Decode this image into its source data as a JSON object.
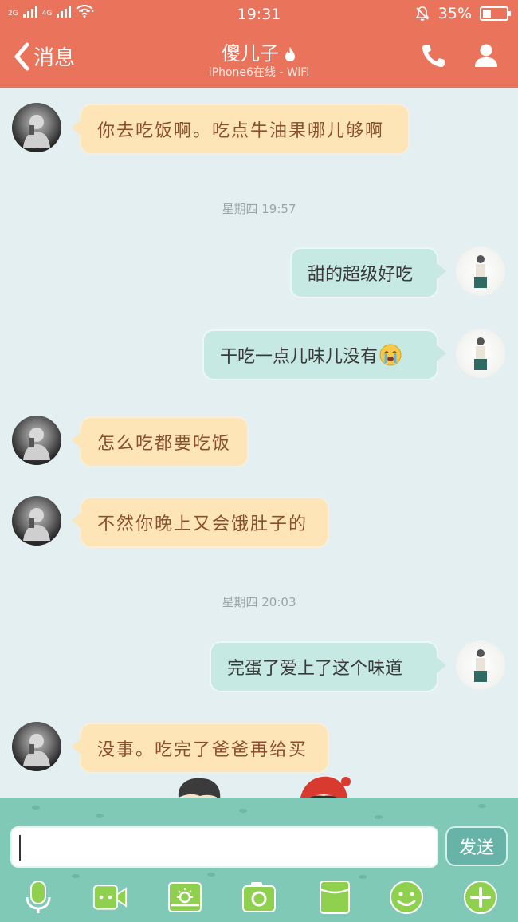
{
  "status_bar": {
    "net1": "2G",
    "net2": "4G",
    "dots": "···",
    "time": "19:31",
    "battery": "35%",
    "battery_level": 0.35
  },
  "header": {
    "back_label": "消息",
    "contact_name": "傻儿子",
    "subtitle": "iPhone6在线 - WiFi",
    "icons": [
      "flame-icon",
      "phone-icon",
      "profile-icon"
    ]
  },
  "messages": [
    {
      "dir": "in",
      "text": "你去吃饭啊。吃点牛油果哪儿够啊"
    },
    {
      "dir": "time",
      "text": "星期四 19:57"
    },
    {
      "dir": "out",
      "text": "甜的超级好吃"
    },
    {
      "dir": "out",
      "text": "干吃一点儿味儿没有",
      "emoji": "crying-emoji"
    },
    {
      "dir": "in",
      "text": "怎么吃都要吃饭"
    },
    {
      "dir": "in",
      "text": "不然你晚上又会饿肚子的"
    },
    {
      "dir": "time",
      "text": "星期四 20:03"
    },
    {
      "dir": "out",
      "text": "完蛋了爱上了这个味道"
    },
    {
      "dir": "in",
      "text": "没事。吃完了爸爸再给买"
    }
  ],
  "composer": {
    "input_value": "",
    "send_label": "发送"
  },
  "toolbar": {
    "icons": [
      "microphone-icon",
      "video-icon",
      "image-icon",
      "camera-icon",
      "file-icon",
      "emoji-icon",
      "plus-icon"
    ]
  },
  "colors": {
    "header": "#ea735c",
    "background": "#e3eff0",
    "incoming_bubble": "#fde5b7",
    "outgoing_bubble": "#c6e9e3",
    "bottom_bar": "#7fc9b6",
    "send_button": "#68b3a8"
  }
}
